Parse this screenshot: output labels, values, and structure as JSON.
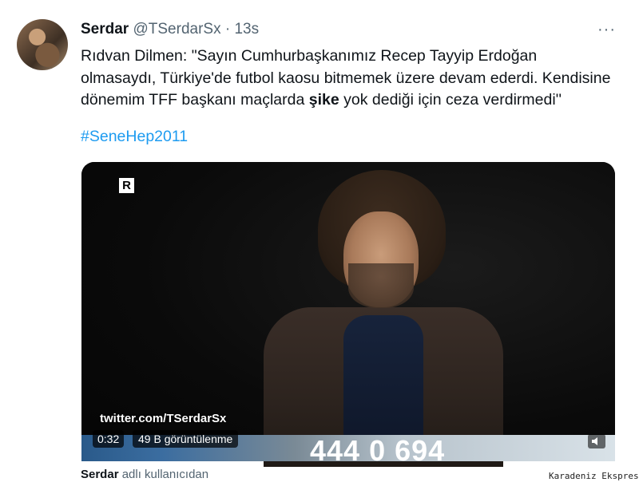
{
  "tweet": {
    "author_name": "Serdar",
    "author_handle": "@TSerdarSx",
    "separator": "·",
    "time": "13s",
    "more_label": "···",
    "text_part1": "Rıdvan Dilmen: \"Sayın Cumhurbaşkanımız Recep Tayyip Erdoğan olmasaydı, Türkiye'de futbol kaosu bitmemek üzere devam ederdi. Kendisine dönemim TFF başkanı maçlarda ",
    "text_bold": "şike",
    "text_part2": " yok dediği için ceza verdirmedi''",
    "hashtag": "#SeneHep2011"
  },
  "media": {
    "channel_logo": "R",
    "watermark": "twitter.com/TSerdarSx",
    "phone_number": "444 0 694",
    "duration": "0:32",
    "views": "49 B görüntülenme",
    "speaker_icon": "speaker-icon"
  },
  "caption": {
    "name": "Serdar",
    "suffix": " adlı kullanıcıdan"
  },
  "source_label": "Karadeniz Ekspres",
  "colors": {
    "link": "#1d9bf0",
    "secondary_text": "#536471",
    "primary_text": "#0f1419"
  }
}
